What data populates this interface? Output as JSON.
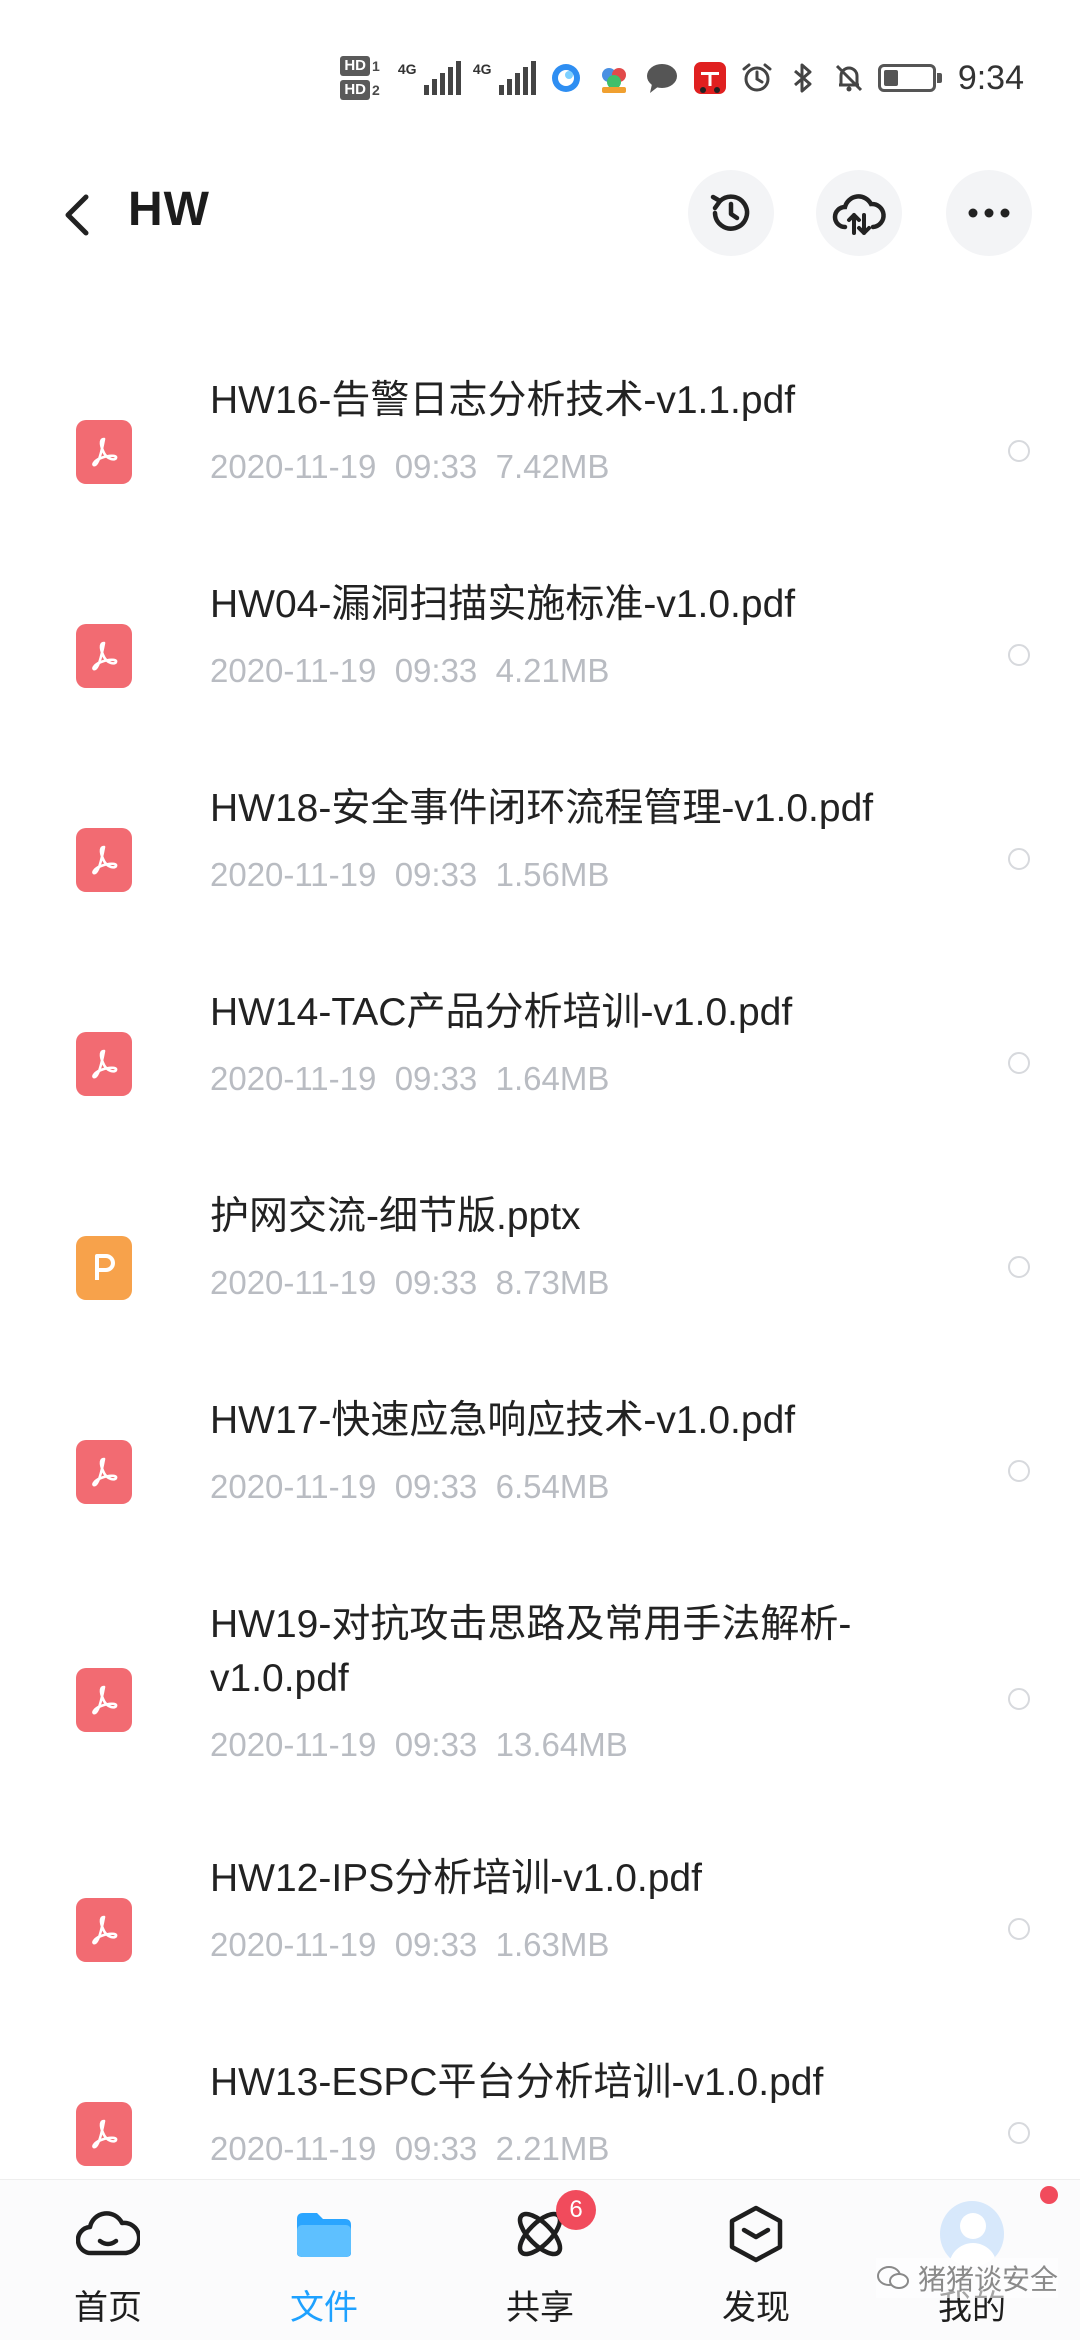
{
  "status_bar": {
    "hd1": "HD",
    "hd1_sim": "1",
    "hd2": "HD",
    "hd2_sim": "2",
    "net1": "4G",
    "net2": "4G",
    "time": "9:34",
    "battery_level": 0.3
  },
  "header": {
    "title": "HW"
  },
  "files": [
    {
      "name": "HW16-告警日志分析技术-v1.1.pdf",
      "type": "pdf",
      "date": "2020-11-19  09:33",
      "size": "7.42MB"
    },
    {
      "name": "HW04-漏洞扫描实施标准-v1.0.pdf",
      "type": "pdf",
      "date": "2020-11-19  09:33",
      "size": "4.21MB"
    },
    {
      "name": "HW18-安全事件闭环流程管理-v1.0.pdf",
      "type": "pdf",
      "date": "2020-11-19  09:33",
      "size": "1.56MB"
    },
    {
      "name": "HW14-TAC产品分析培训-v1.0.pdf",
      "type": "pdf",
      "date": "2020-11-19  09:33",
      "size": "1.64MB"
    },
    {
      "name": "护网交流-细节版.pptx",
      "type": "pptx",
      "date": "2020-11-19  09:33",
      "size": "8.73MB"
    },
    {
      "name": "HW17-快速应急响应技术-v1.0.pdf",
      "type": "pdf",
      "date": "2020-11-19  09:33",
      "size": "6.54MB"
    },
    {
      "name": "HW19-对抗攻击思路及常用手法解析-v1.0.pdf",
      "type": "pdf",
      "date": "2020-11-19  09:33",
      "size": "13.64MB"
    },
    {
      "name": "HW12-IPS分析培训-v1.0.pdf",
      "type": "pdf",
      "date": "2020-11-19  09:33",
      "size": "1.63MB"
    },
    {
      "name": "HW13-ESPC平台分析培训-v1.0.pdf",
      "type": "pdf",
      "date": "2020-11-19  09:33",
      "size": "2.21MB"
    }
  ],
  "bottom_nav": {
    "items": [
      {
        "label": "首页",
        "icon": "cloud-home-icon"
      },
      {
        "label": "文件",
        "icon": "folder-icon",
        "active": true
      },
      {
        "label": "共享",
        "icon": "atom-share-icon",
        "badge": "6"
      },
      {
        "label": "发现",
        "icon": "cube-discover-icon"
      },
      {
        "label": "我的",
        "icon": "avatar-icon"
      }
    ]
  },
  "watermark": "猪猪谈安全",
  "colors": {
    "accent": "#1ea1ff",
    "pdf": "#f26b72",
    "pptx": "#f7a24b",
    "badge": "#f14b5c",
    "meta_text": "#b9bcc2"
  }
}
